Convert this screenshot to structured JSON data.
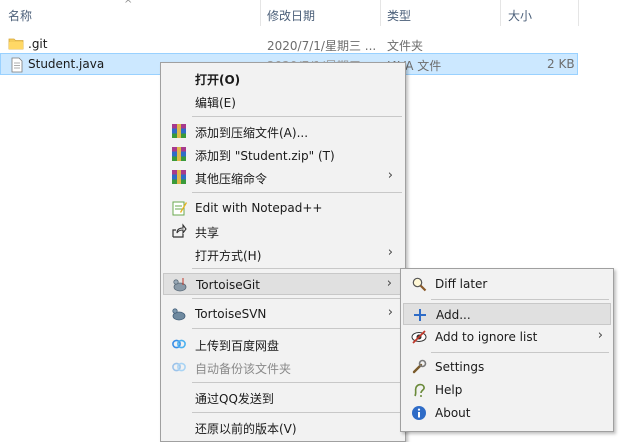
{
  "columns": {
    "name": "名称",
    "modified": "修改日期",
    "type": "类型",
    "size": "大小"
  },
  "files": [
    {
      "name": ".git",
      "modified": "2020/7/1/星期三 ...",
      "type": "文件夹",
      "size": "",
      "icon": "folder-icon"
    },
    {
      "name": "Student.java",
      "modified": "2020/7/1/星期三 ...",
      "type": "JAVA 文件",
      "size": "2 KB",
      "icon": "java-file-icon"
    }
  ],
  "context_menu": {
    "open": "打开(O)",
    "edit": "编辑(E)",
    "add_archive": "添加到压缩文件(A)...",
    "add_zip": "添加到 \"Student.zip\" (T)",
    "other_compress": "其他压缩命令",
    "notepad": "Edit with Notepad++",
    "share": "共享",
    "open_with": "打开方式(H)",
    "tortoisegit": "TortoiseGit",
    "tortoisesvn": "TortoiseSVN",
    "baidu_upload": "上传到百度网盘",
    "auto_backup": "自动备份该文件夹",
    "qq_send": "通过QQ发送到",
    "restore": "还原以前的版本(V)"
  },
  "submenu": {
    "diff_later": "Diff later",
    "add": "Add...",
    "ignore": "Add to ignore list",
    "settings": "Settings",
    "help": "Help",
    "about": "About"
  },
  "colors": {
    "selection_bg": "#cce8ff",
    "menu_bg": "#f2f2f2",
    "menu_highlight": "#e0e0e0"
  }
}
